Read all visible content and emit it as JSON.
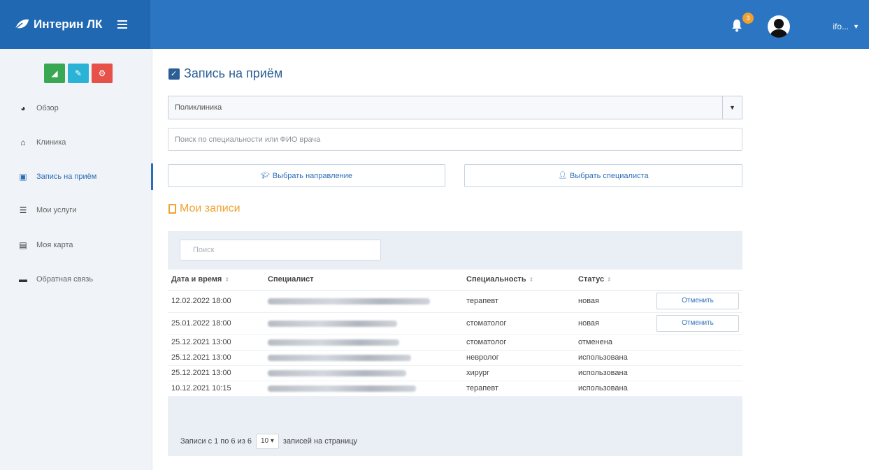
{
  "app": {
    "title": "Интерин ЛК"
  },
  "header": {
    "notifications_count": "3",
    "username": "        ifo..."
  },
  "sidebar": {
    "quick_buttons": [
      "chart-icon",
      "edit-icon",
      "settings-icon"
    ],
    "items": [
      {
        "label": "Обзор",
        "icon": "pie-chart-icon"
      },
      {
        "label": "Клиника",
        "icon": "hospital-icon"
      },
      {
        "label": "Запись на приём",
        "icon": "calendar-check-icon"
      },
      {
        "label": "Мои услуги",
        "icon": "list-icon"
      },
      {
        "label": "Моя карта",
        "icon": "card-icon"
      },
      {
        "label": "Обратная связь",
        "icon": "comment-icon"
      }
    ]
  },
  "main": {
    "title": "Запись на приём",
    "clinic_select": {
      "value": "Поликлиника"
    },
    "search": {
      "placeholder": "Поиск по специальности или ФИО врача"
    },
    "buttons": {
      "direction": "Выбрать направление",
      "specialist": "Выбрать специалиста"
    },
    "records_title": "Мои записи",
    "table": {
      "search_placeholder": "Поиск",
      "headers": [
        "Дата и время",
        "Специалист",
        "Специальность",
        "Статус"
      ],
      "rows": [
        {
          "datetime": "12.02.2022 18:00",
          "specialty": "терапевт",
          "status": "новая",
          "status_type": "new",
          "action": "Отменить"
        },
        {
          "datetime": "25.01.2022 18:00",
          "specialty": "стоматолог",
          "status": "новая",
          "status_type": "new",
          "action": "Отменить"
        },
        {
          "datetime": "25.12.2021 13:00",
          "specialty": "стоматолог",
          "status": "отменена",
          "status_type": "cancel"
        },
        {
          "datetime": "25.12.2021 13:00",
          "specialty": "невролог",
          "status": "использована",
          "status_type": "used"
        },
        {
          "datetime": "25.12.2021 13:00",
          "specialty": "хирург",
          "status": "использована",
          "status_type": "used"
        },
        {
          "datetime": "10.12.2021 10:15",
          "specialty": "терапевт",
          "status": "использована",
          "status_type": "used"
        }
      ],
      "footer": {
        "info": "Записи с 1 по 6 из 6",
        "page_size": "10",
        "per_page_label": "записей на страницу"
      }
    }
  },
  "colors": {
    "header": "#2b75c2",
    "accent": "#2a6cb5",
    "orange": "#f0a232",
    "success": "#4fa046",
    "danger": "#d33b36"
  }
}
